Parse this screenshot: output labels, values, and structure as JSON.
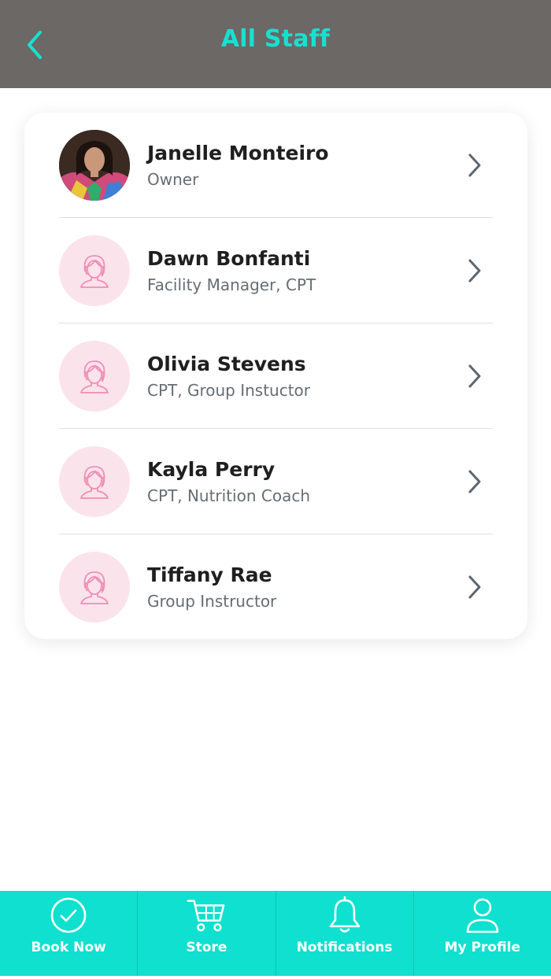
{
  "header": {
    "title": "All Staff",
    "back_icon": "chevron-left-icon"
  },
  "colors": {
    "header_bg": "#6b6866",
    "accent": "#18e0d0",
    "tabbar_bg": "#10e0cf",
    "avatar_placeholder_bg": "#fbe3ec",
    "avatar_placeholder_stroke": "#f08fb1"
  },
  "staff": [
    {
      "name": "Janelle Monteiro",
      "role": "Owner",
      "avatar": "photo"
    },
    {
      "name": "Dawn Bonfanti",
      "role": "Facility Manager, CPT",
      "avatar": "female-placeholder-icon"
    },
    {
      "name": "Olivia Stevens",
      "role": "CPT, Group Instuctor",
      "avatar": "female-placeholder-icon"
    },
    {
      "name": "Kayla Perry",
      "role": "CPT, Nutrition Coach",
      "avatar": "female-placeholder-icon"
    },
    {
      "name": "Tiffany Rae",
      "role": "Group Instructor",
      "avatar": "female-placeholder-icon"
    }
  ],
  "tabs": [
    {
      "label": "Book Now",
      "icon": "check-circle-icon"
    },
    {
      "label": "Store",
      "icon": "cart-icon"
    },
    {
      "label": "Notifications",
      "icon": "bell-icon"
    },
    {
      "label": "My Profile",
      "icon": "user-icon"
    }
  ]
}
